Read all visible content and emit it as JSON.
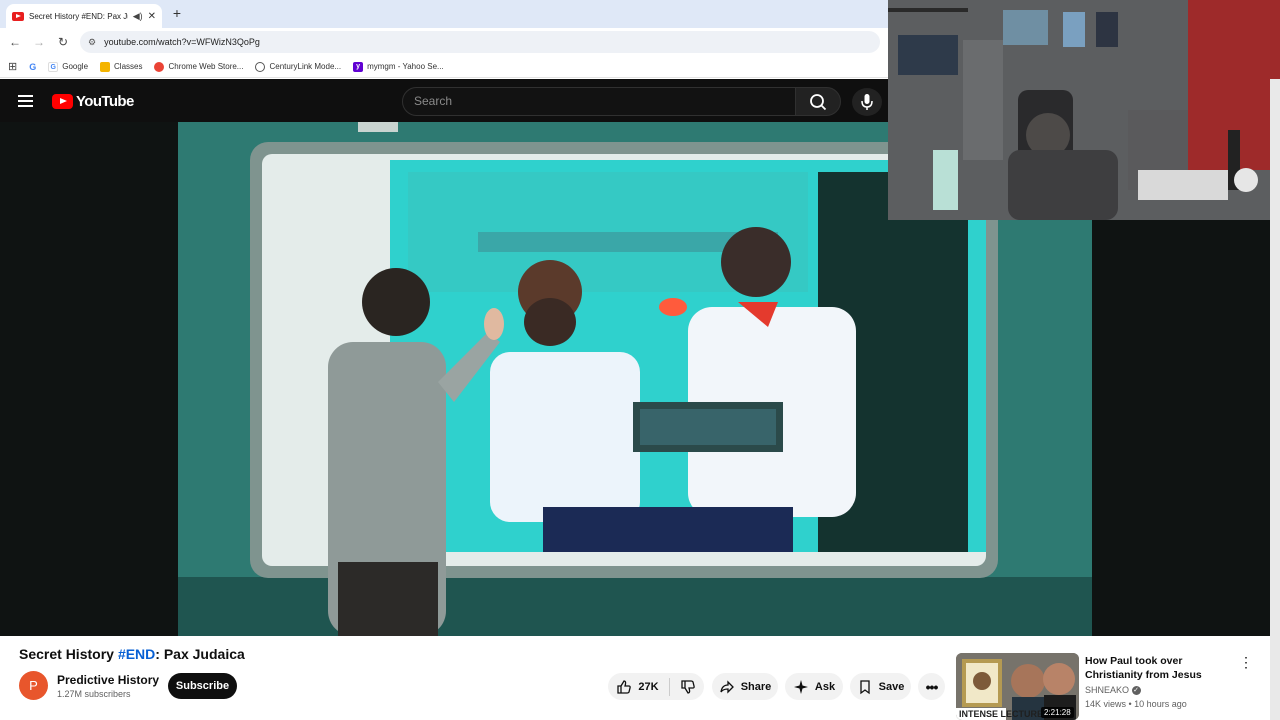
{
  "browser": {
    "tab": {
      "title": "Secret History #END: Pax Judaica"
    },
    "address": "youtube.com/watch?v=WFWizN3QoPg",
    "bookmarks": [
      {
        "label": "Google",
        "color": "#4285f4",
        "icon": "G"
      },
      {
        "label": "Classes",
        "color": "#f4b400",
        "icon": ""
      },
      {
        "label": "Chrome Web Store...",
        "color": "#ea4335",
        "icon": ""
      },
      {
        "label": "CenturyLink Mode...",
        "color": "#555555",
        "icon": ""
      },
      {
        "label": "mymgm - Yahoo Se...",
        "color": "#6001d2",
        "icon": "Y"
      }
    ]
  },
  "youtube": {
    "logo_text": "YouTube",
    "search_placeholder": "Search",
    "video": {
      "title_pre": "Secret History",
      "hashtag": "#END",
      "title_post": ": Pax Judaica"
    },
    "channel": {
      "avatar_letter": "P",
      "name": "Predictive History",
      "subscribers": "1.27M subscribers",
      "subscribe_label": "Subscribe"
    },
    "actions": {
      "likes": "27K",
      "share": "Share",
      "ask": "Ask",
      "save": "Save"
    },
    "recommendation": {
      "title": "How Paul took over Christianity from Jesus",
      "channel": "SHNEAKO",
      "meta": "14K views • 10 hours ago",
      "duration": "2:21:28",
      "badge_text": "INTENSE LECTURE"
    }
  },
  "colors": {
    "youtube_red": "#ff0000",
    "hashtag_blue": "#065fd4",
    "avatar": "#e8562c"
  }
}
